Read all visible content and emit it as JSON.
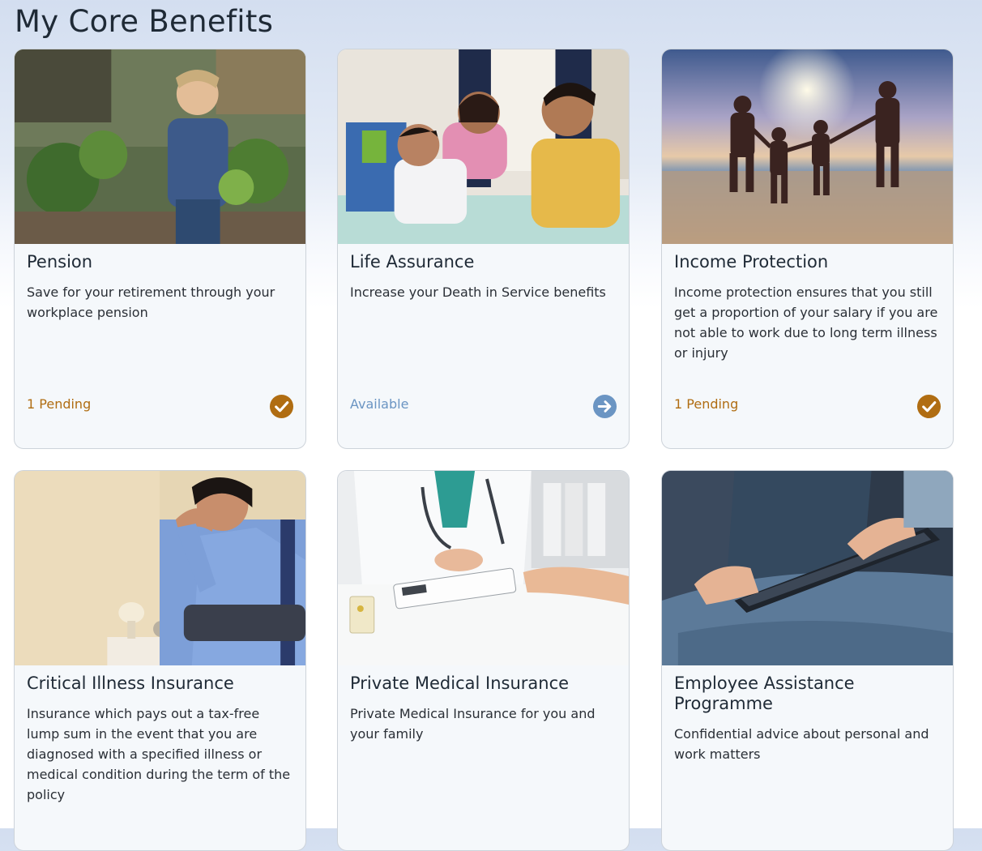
{
  "page": {
    "title": "My Core Benefits"
  },
  "colors": {
    "pending": "#b06d12",
    "available": "#6b95c3"
  },
  "cards": [
    {
      "title": "Pension",
      "description": "Save for your retirement through your workplace pension",
      "status": "1 Pending",
      "status_type": "pending",
      "icon": "check-circle-icon",
      "image": "woman-gardening-photo"
    },
    {
      "title": "Life Assurance",
      "description": "Increase your Death in Service benefits",
      "status": "Available",
      "status_type": "available",
      "icon": "arrow-right-circle-icon",
      "image": "family-on-bed-photo"
    },
    {
      "title": "Income Protection",
      "description": "Income protection ensures that you still get a proportion of your salary if you are not able to work due to long term illness or injury",
      "status": "1 Pending",
      "status_type": "pending",
      "icon": "check-circle-icon",
      "image": "family-beach-sunset-photo"
    },
    {
      "title": "Critical Illness Insurance",
      "description": "Insurance which pays out a tax-free lump sum in the event that you are diagnosed with a specified illness or medical condition during the term of the policy",
      "image": "stressed-man-photo"
    },
    {
      "title": "Private Medical Insurance",
      "description": "Private Medical Insurance for you and your family",
      "image": "doctor-consultation-photo"
    },
    {
      "title": "Employee Assistance Programme",
      "description": "Confidential advice about personal and work matters",
      "image": "person-with-tablet-photo"
    }
  ]
}
